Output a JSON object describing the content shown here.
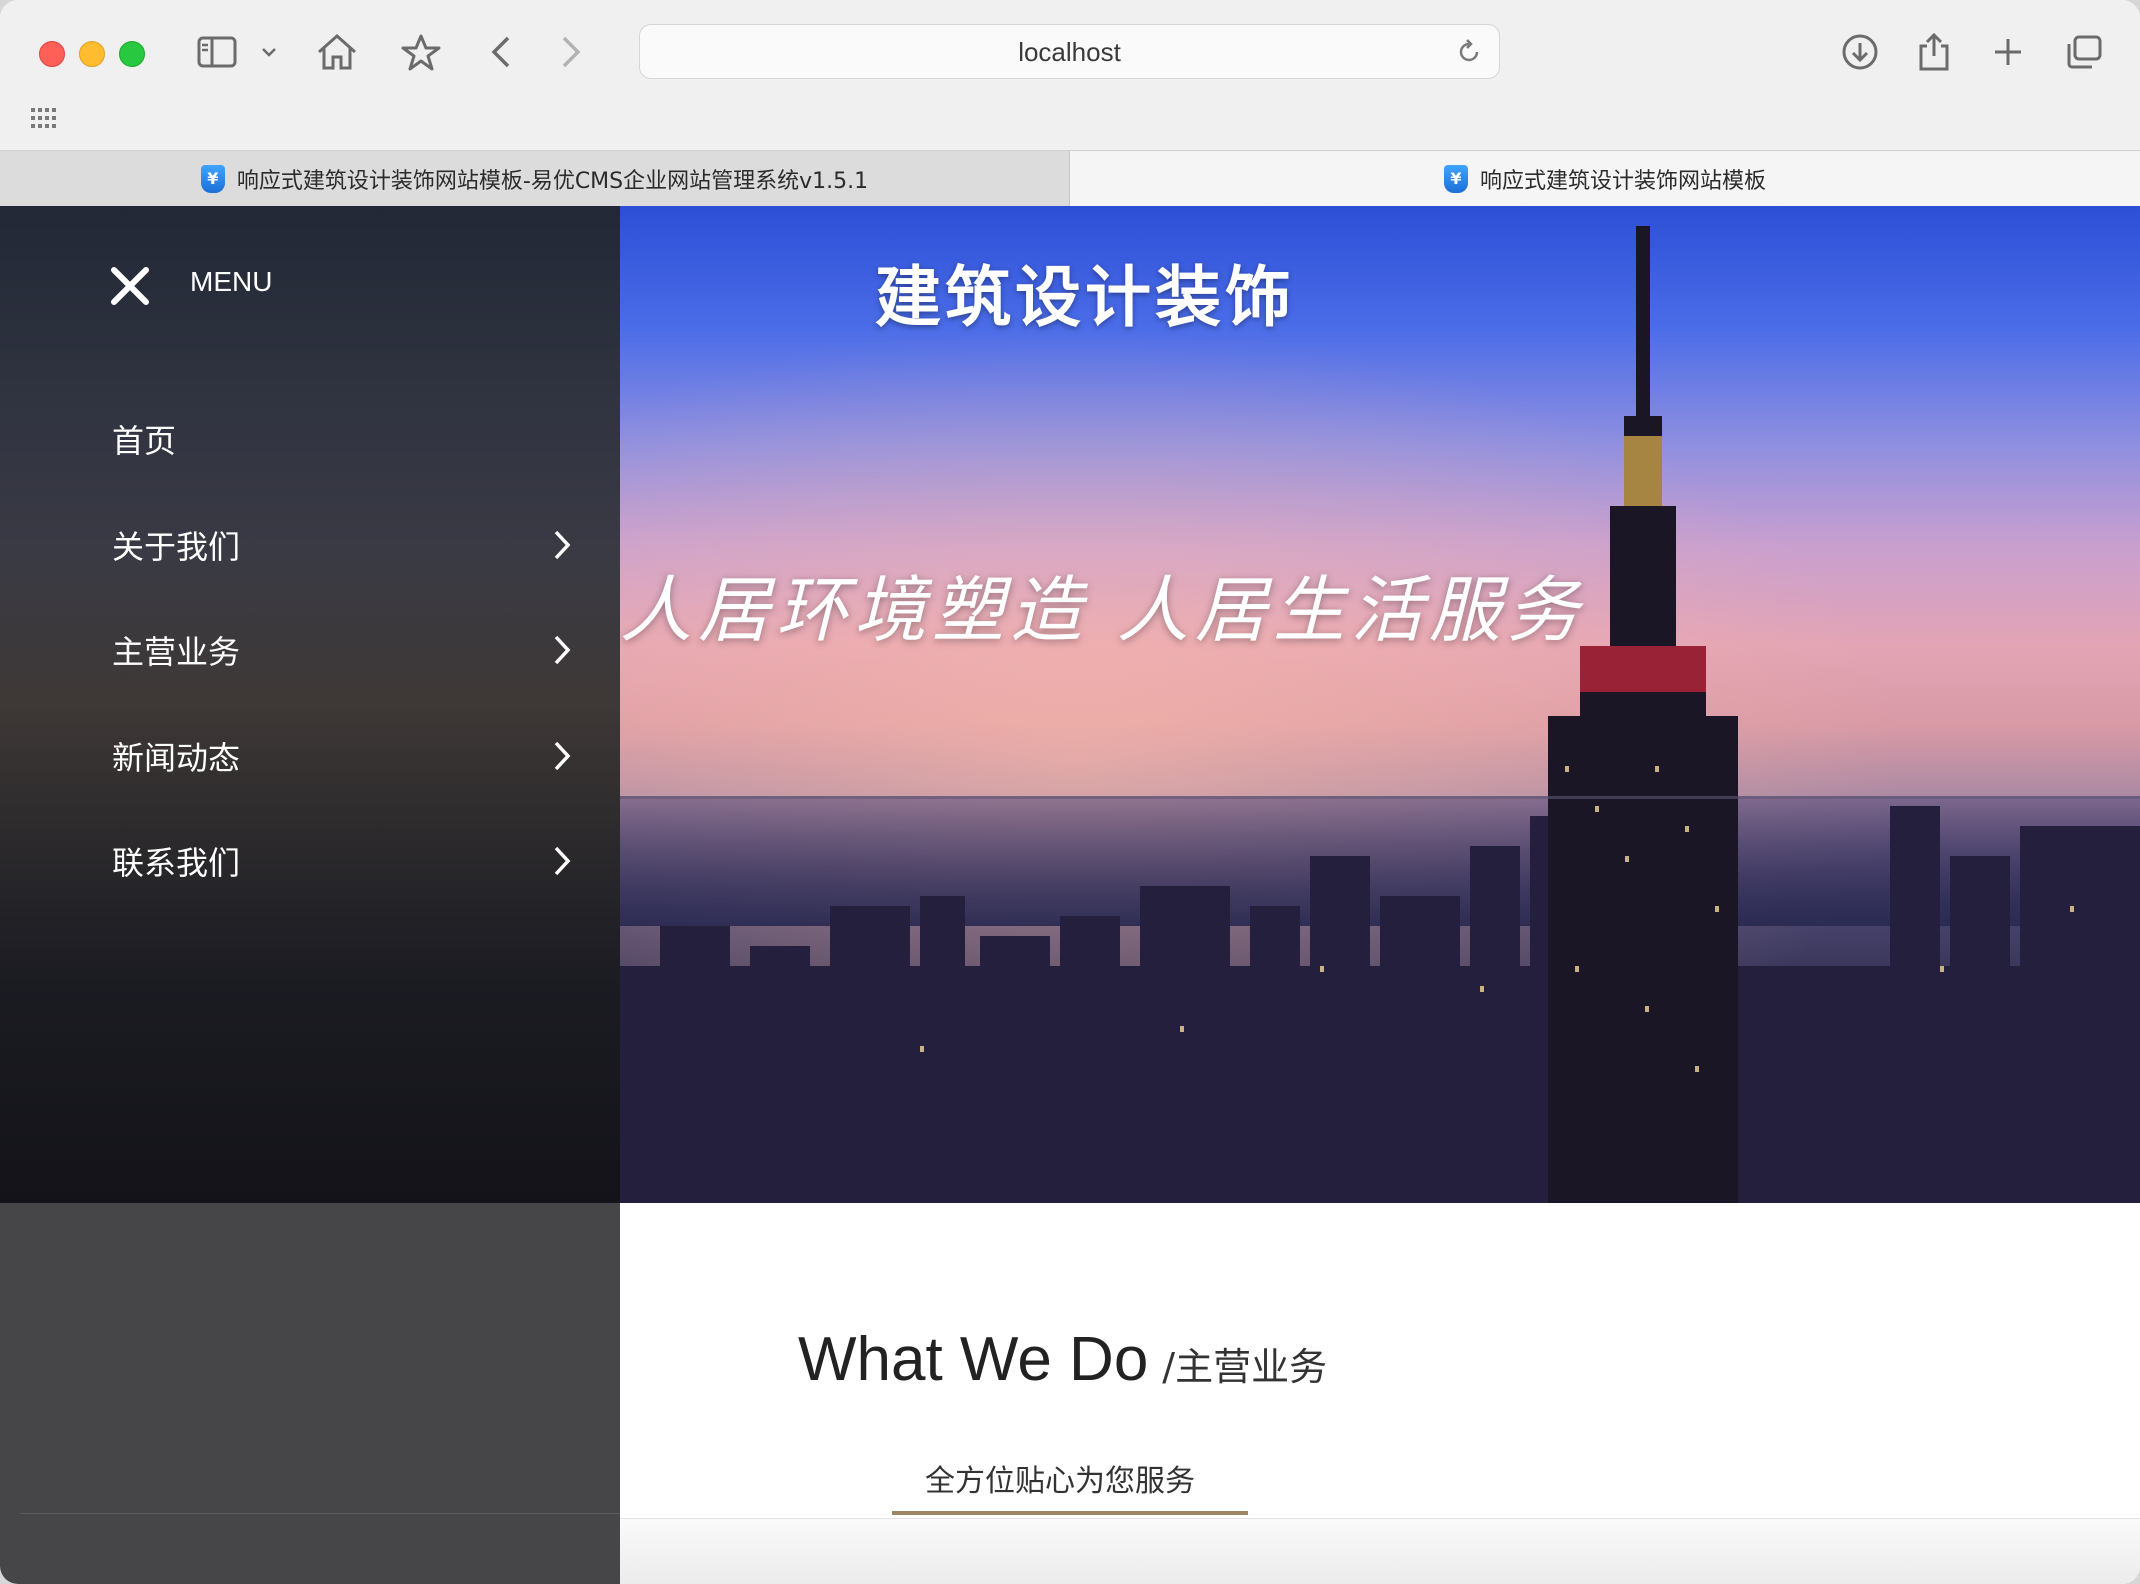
{
  "browser": {
    "url": "localhost",
    "tabs": [
      {
        "label": "响应式建筑设计装饰网站模板-易优CMS企业网站管理系统v1.5.1",
        "active": false
      },
      {
        "label": "响应式建筑设计装饰网站模板",
        "active": true
      }
    ],
    "favicon_glyph": "¥"
  },
  "menu": {
    "header_label": "MENU",
    "items": [
      {
        "label": "首页",
        "has_submenu": false
      },
      {
        "label": "关于我们",
        "has_submenu": true
      },
      {
        "label": "主营业务",
        "has_submenu": true
      },
      {
        "label": "新闻动态",
        "has_submenu": true
      },
      {
        "label": "联系我们",
        "has_submenu": true
      }
    ]
  },
  "hero": {
    "title": "建筑设计装饰",
    "slogan": "人居环境塑造 人居生活服务"
  },
  "section": {
    "title_en": "What We Do",
    "title_zh": "/主营业务",
    "subtitle": "全方位贴心为您服务"
  },
  "colors": {
    "accent_underline": "#9e8563",
    "sidebar_bottom": "#464547",
    "traffic_red": "#fe5f57",
    "traffic_yellow": "#febc2e",
    "traffic_green": "#28c840"
  }
}
